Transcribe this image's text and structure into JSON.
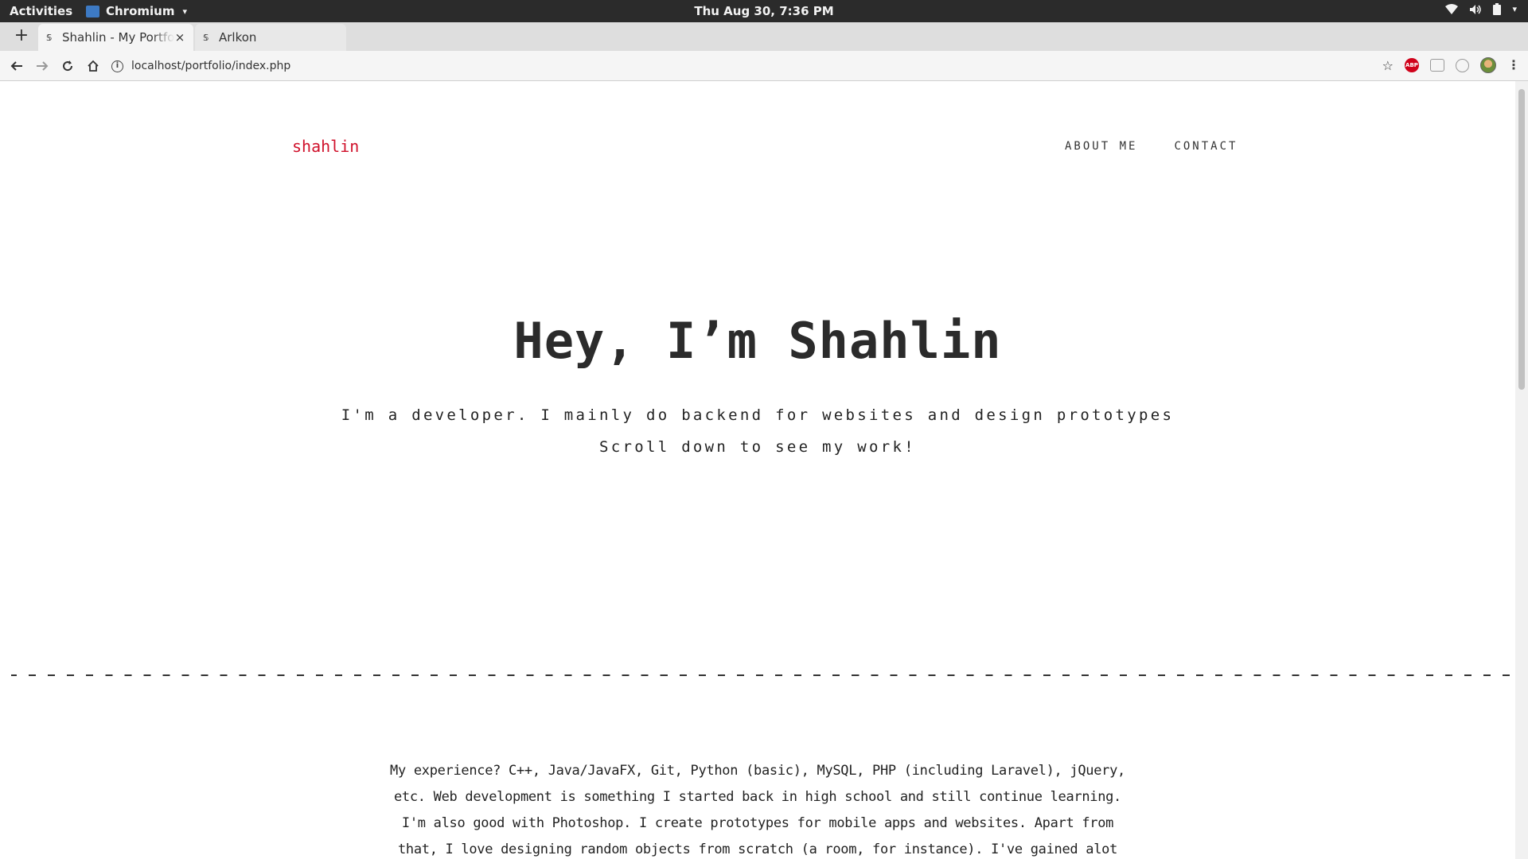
{
  "system_bar": {
    "activities": "Activities",
    "app_name": "Chromium",
    "clock": "Thu Aug 30,  7:36 PM"
  },
  "browser": {
    "new_tab": "+",
    "tabs": [
      {
        "title": "Shahlin - My Portfolio",
        "active": true,
        "close": "×"
      },
      {
        "title": "Arlkon",
        "active": false
      }
    ],
    "url": "localhost/portfolio/index.php",
    "extension_abp": "ABP"
  },
  "page": {
    "brand": "shahlin",
    "nav": [
      "ABOUT ME",
      "CONTACT"
    ],
    "hero_title": "Hey, I’m Shahlin",
    "hero_subtitle": "I'm a developer. I mainly do backend for websites and design prototypes",
    "hero_cta": "Scroll down to see my work!",
    "about_text": "My experience? C++, Java/JavaFX, Git, Python (basic), MySQL, PHP (including Laravel), jQuery, etc. Web development is something I started back in high school and still continue learning. I'm also good with Photoshop. I create prototypes for mobile apps and websites. Apart from that, I love designing random objects from scratch (a room, for instance). I've gained alot of experience in"
  },
  "colors": {
    "brand": "#d0112b",
    "text": "#2b2b2b",
    "topbar": "#2b2b2b"
  }
}
